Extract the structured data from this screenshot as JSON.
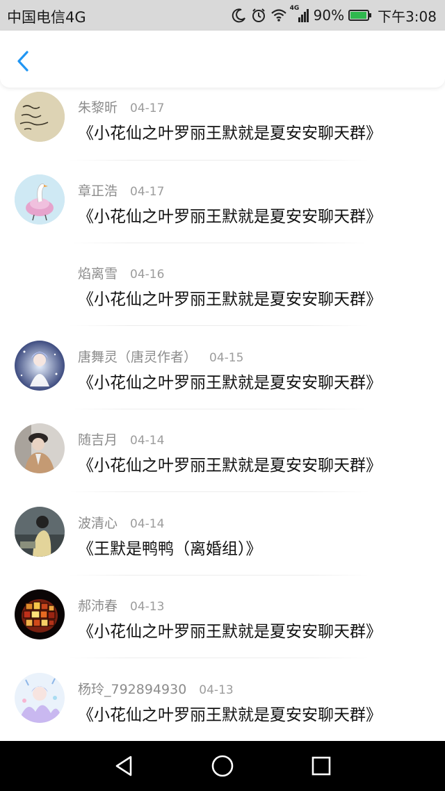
{
  "status_bar": {
    "carrier": "中国电信4G",
    "network_badge": "4G",
    "battery_percent": "90%",
    "time": "下午3:08",
    "icons": [
      "moon-icon",
      "alarm-icon",
      "wifi-icon",
      "signal-icon",
      "battery-icon"
    ],
    "battery_level": 0.9
  },
  "header": {
    "back_icon": "chevron-left-icon",
    "accent_color": "#2196f3"
  },
  "items": [
    {
      "name": "朱黎昕",
      "date": "04-17",
      "message": "《小花仙之叶罗丽王默就是夏安安聊天群》",
      "avatar": "handwriting-avatar"
    },
    {
      "name": "章正浩",
      "date": "04-17",
      "message": "《小花仙之叶罗丽王默就是夏安安聊天群》",
      "avatar": "goose-avatar"
    },
    {
      "name": "焰离雪",
      "date": "04-16",
      "message": "《小花仙之叶罗丽王默就是夏安安聊天群》",
      "avatar": "none"
    },
    {
      "name": "唐舞灵（唐灵作者）",
      "date": "04-15",
      "message": "《小花仙之叶罗丽王默就是夏安安聊天群》",
      "avatar": "anime-girl-avatar"
    },
    {
      "name": "随吉月",
      "date": "04-14",
      "message": "《小花仙之叶罗丽王默就是夏安安聊天群》",
      "avatar": "person-hat-avatar"
    },
    {
      "name": "波清心",
      "date": "04-14",
      "message": "《王默是鸭鸭（离婚组）》",
      "avatar": "person-photo-avatar"
    },
    {
      "name": "郝沛春",
      "date": "04-13",
      "message": "《小花仙之叶罗丽王默就是夏安安聊天群》",
      "avatar": "mosaic-lamp-avatar"
    },
    {
      "name": "杨玲_792894930",
      "date": "04-13",
      "message": "《小花仙之叶罗丽王默就是夏安安聊天群》",
      "avatar": "anime-avatar"
    }
  ],
  "nav_bar": {
    "back": "triangle-back-icon",
    "home": "circle-home-icon",
    "recents": "square-recents-icon"
  }
}
